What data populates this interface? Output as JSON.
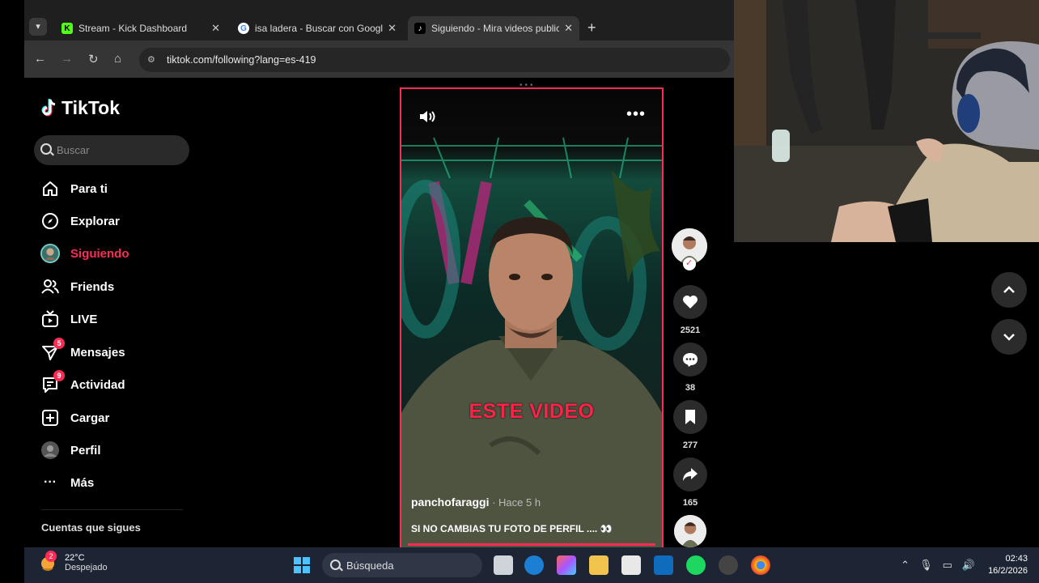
{
  "browser": {
    "tabs": [
      {
        "title": "Stream - Kick Dashboard",
        "favicon": "kick-icon",
        "active": false
      },
      {
        "title": "isa ladera - Buscar con Google",
        "favicon": "google-icon",
        "active": false
      },
      {
        "title": "Siguiendo - Mira videos publica",
        "favicon": "tiktok-icon",
        "active": true
      }
    ],
    "url": "tiktok.com/following?lang=es-419"
  },
  "tiktok": {
    "logo_text": "TikTok",
    "search_placeholder": "Buscar",
    "nav": [
      {
        "label": "Para ti",
        "icon": "home-icon"
      },
      {
        "label": "Explorar",
        "icon": "compass-icon"
      },
      {
        "label": "Siguiendo",
        "icon": "following-avatar-icon",
        "active": true
      },
      {
        "label": "Friends",
        "icon": "friends-icon"
      },
      {
        "label": "LIVE",
        "icon": "live-tv-icon"
      },
      {
        "label": "Mensajes",
        "icon": "messages-icon",
        "badge": "5"
      },
      {
        "label": "Actividad",
        "icon": "activity-icon",
        "badge": "9"
      },
      {
        "label": "Cargar",
        "icon": "upload-icon"
      },
      {
        "label": "Perfil",
        "icon": "profile-avatar-icon"
      },
      {
        "label": "Más",
        "icon": "more-icon"
      }
    ],
    "following_header": "Cuentas que sigues",
    "accent": "#fe2c55"
  },
  "video": {
    "overlay_caption": "ESTE VIDEO",
    "author": "panchofaraggi",
    "time": " · Hace 5 h",
    "description": "SI NO CAMBIAS TU FOTO DE PERFIL .... 👀",
    "likes": "2521",
    "comments": "38",
    "saves": "277",
    "shares": "165"
  },
  "taskbar": {
    "temperature": "22°C",
    "weather": "Despejado",
    "weather_badge": "2",
    "search_label": "Búsqueda",
    "time": "02:43",
    "date": "16/2/2026"
  }
}
